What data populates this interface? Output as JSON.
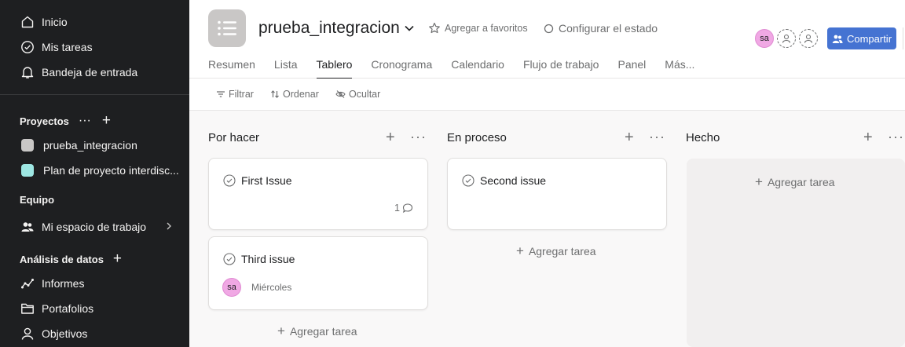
{
  "sidebar": {
    "top_items": [
      {
        "label": "Inicio",
        "icon": "home-icon"
      },
      {
        "label": "Mis tareas",
        "icon": "check-circle-icon"
      },
      {
        "label": "Bandeja de entrada",
        "icon": "bell-icon"
      }
    ],
    "projects_heading": "Proyectos",
    "projects_more": "···",
    "projects_add": "+",
    "projects": [
      {
        "label": "prueba_integracion",
        "color": "#c9c7c6"
      },
      {
        "label": "Plan de proyecto interdisc...",
        "color": "#9ee7e3"
      }
    ],
    "team_heading": "Equipo",
    "team_item": "Mi espacio de trabajo",
    "analytics_heading": "Análisis de datos",
    "analytics_add": "+",
    "analytics_items": [
      {
        "label": "Informes",
        "icon": "chart-line-icon"
      },
      {
        "label": "Portafolios",
        "icon": "folder-icon"
      },
      {
        "label": "Objetivos",
        "icon": "person-icon"
      }
    ]
  },
  "header": {
    "title": "prueba_integracion",
    "favorite": "Agregar a favoritos",
    "status": "Configurar el estado",
    "avatar_initials": "sa",
    "share": "Compartir",
    "tabs": [
      "Resumen",
      "Lista",
      "Tablero",
      "Cronograma",
      "Calendario",
      "Flujo de trabajo",
      "Panel",
      "Más..."
    ],
    "active_tab": "Tablero"
  },
  "toolbar": {
    "filter": "Filtrar",
    "sort": "Ordenar",
    "hide": "Ocultar"
  },
  "board": {
    "columns": [
      {
        "title": "Por hacer",
        "cards": [
          {
            "name": "First Issue",
            "comments": "1"
          },
          {
            "name": "Third issue",
            "assignee": "sa",
            "due": "Miércoles"
          }
        ],
        "add_label": "Agregar tarea"
      },
      {
        "title": "En proceso",
        "cards": [
          {
            "name": "Second issue"
          }
        ],
        "add_label": "Agregar tarea"
      },
      {
        "title": "Hecho",
        "cards": [],
        "add_label": "Agregar tarea"
      }
    ],
    "add_symbol": "+",
    "more_symbol": "···"
  },
  "colors": {
    "sidebar_bg": "#1e1f21",
    "accent": "#4573d2",
    "avatar": "#f0a8e4"
  }
}
